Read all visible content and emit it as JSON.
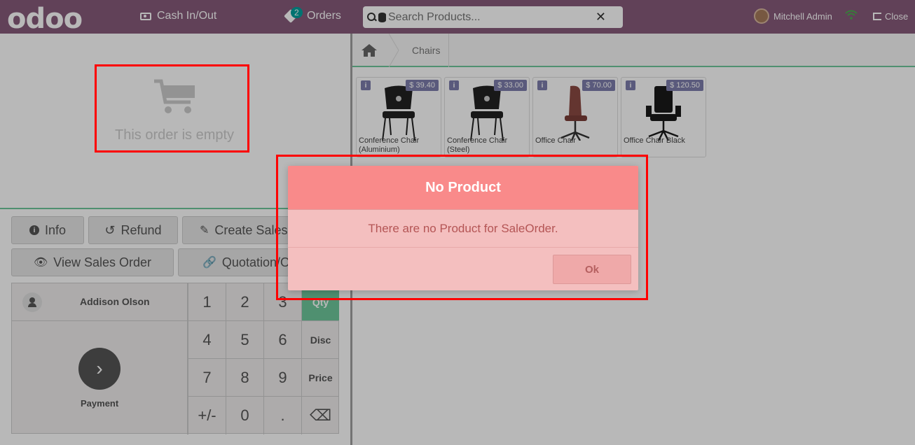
{
  "header": {
    "logo": "odoo",
    "cash_in_out": "Cash In/Out",
    "orders_label": "Orders",
    "orders_count": "2",
    "search_placeholder": "Search Products...",
    "user_name": "Mitchell Admin",
    "close_label": "Close",
    "colors": {
      "brand": "#875a7b",
      "accent": "#00a09d"
    }
  },
  "order": {
    "empty_text": "This order is empty"
  },
  "actions": {
    "info": "Info",
    "refund": "Refund",
    "create_sales": "Create Sales",
    "view_sales_order": "View Sales Order",
    "quotation": "Quotation/O"
  },
  "keypad": {
    "customer": "Addison Olson",
    "payment": "Payment",
    "keys": [
      "1",
      "2",
      "3",
      "Qty",
      "4",
      "5",
      "6",
      "Disc",
      "7",
      "8",
      "9",
      "Price",
      "+/-",
      "0",
      ".",
      "⌫"
    ]
  },
  "breadcrumb": {
    "category": "Chairs"
  },
  "products": [
    {
      "name": "Conference Chair (Aluminium)",
      "price": "$ 39.40"
    },
    {
      "name": "Conference Chair (Steel)",
      "price": "$ 33.00"
    },
    {
      "name": "Office Chair",
      "price": "$ 70.00"
    },
    {
      "name": "Office Chair Black",
      "price": "$ 120.50"
    }
  ],
  "dialog": {
    "title": "No Product",
    "message": "There are no Product for SaleOrder.",
    "ok": "Ok"
  }
}
